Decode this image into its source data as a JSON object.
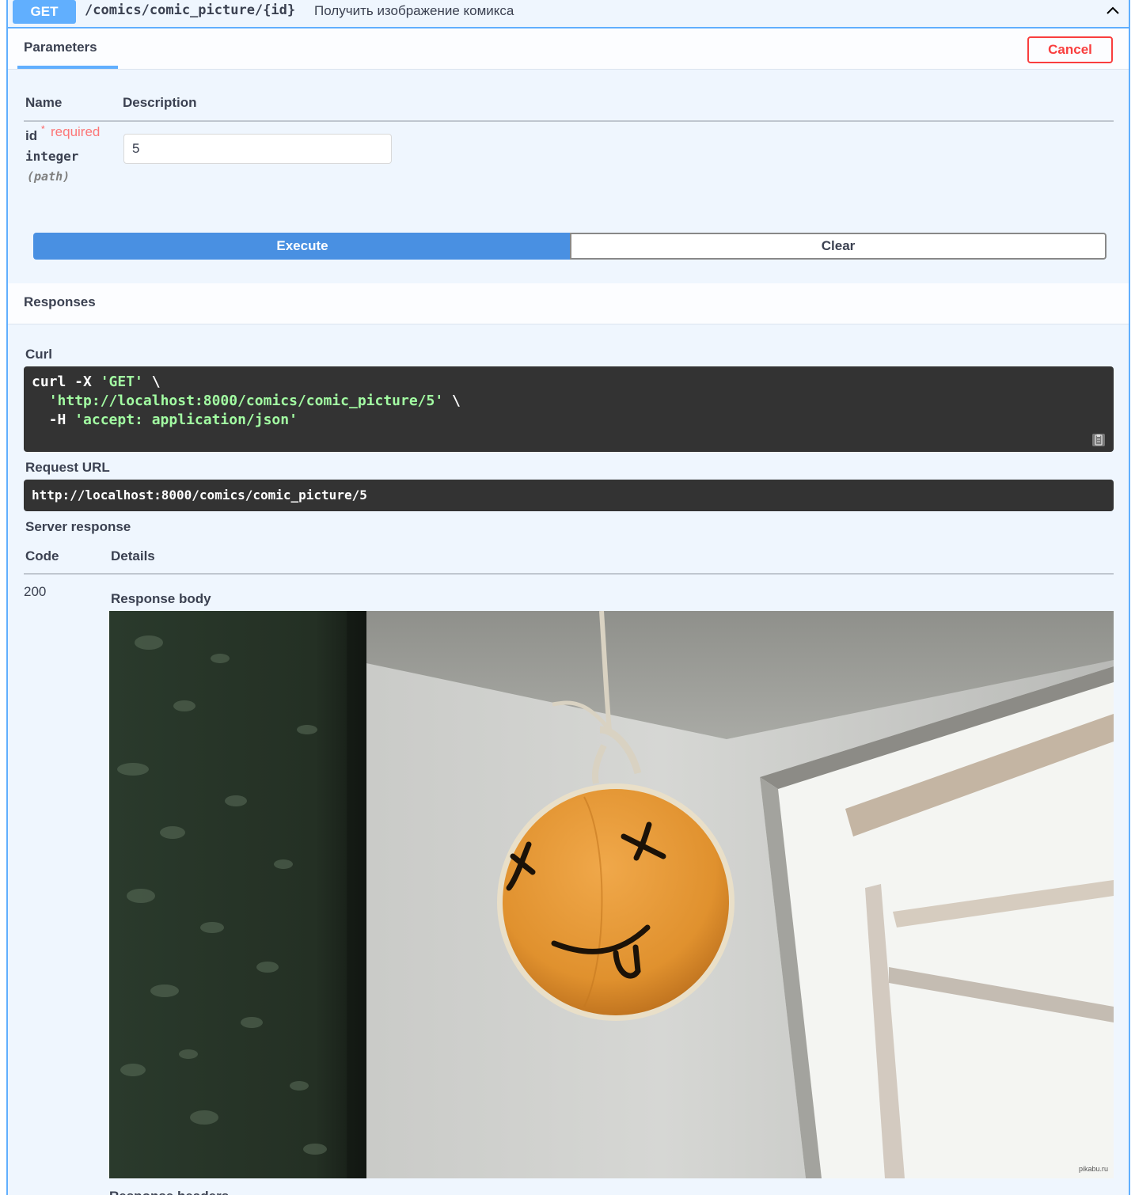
{
  "operation": {
    "method": "GET",
    "path": "/comics/comic_picture/{id}",
    "summary": "Получить изображение комикса",
    "collapse_icon": "chevron-up-icon"
  },
  "parameters": {
    "tab_title": "Parameters",
    "cancel_label": "Cancel",
    "col_name": "Name",
    "col_description": "Description",
    "items": [
      {
        "name": "id",
        "required_star": "*",
        "required_label": "required",
        "type": "integer",
        "in": "(path)",
        "value": "5"
      }
    ],
    "execute_label": "Execute",
    "clear_label": "Clear"
  },
  "responses": {
    "title": "Responses",
    "curl_label": "Curl",
    "curl": {
      "cmd": "curl -X ",
      "method": "'GET'",
      "cont1": " \\",
      "indent": "  ",
      "url": "'http://localhost:8000/comics/comic_picture/5'",
      "cont2": " \\",
      "header_flag": "  -H ",
      "header": "'accept: application/json'"
    },
    "copy_icon": "clipboard-icon",
    "request_url_label": "Request URL",
    "request_url": "http://localhost:8000/comics/comic_picture/5",
    "server_response_label": "Server response",
    "col_code": "Code",
    "col_details": "Details",
    "code": "200",
    "response_body_label": "Response body",
    "image_watermark": "pikabu.ru",
    "response_headers_label": "Response headers"
  },
  "colors": {
    "get_blue": "#61affe",
    "execute_blue": "#4990e2",
    "cancel_red": "#f93e3e",
    "code_bg": "#333333",
    "string_green": "#a2fca2"
  }
}
